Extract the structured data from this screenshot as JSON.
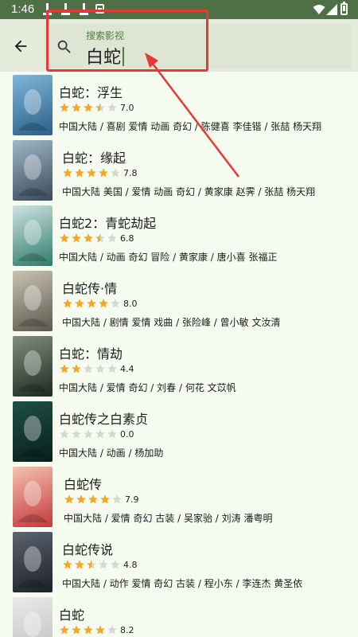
{
  "status_bar": {
    "time": "1:46"
  },
  "search": {
    "label": "搜索影视",
    "value": "白蛇"
  },
  "results": [
    {
      "title": "白蛇：浮生",
      "rating": 3.5,
      "score": "7.0",
      "meta": "中国大陆 / 喜剧 爱情 动画 奇幻 / 陈健喜 李佳锴 / 张喆 杨天翔",
      "colors": [
        "#7fb6d8",
        "#2c5f8a"
      ]
    },
    {
      "title": "白蛇：缘起",
      "rating": 4,
      "score": "7.8",
      "meta": "中国大陆 美国 / 爱情 动画 奇幻 / 黄家康 赵霁 / 张喆 杨天翔",
      "colors": [
        "#9fb7c8",
        "#3b4a5a"
      ]
    },
    {
      "title": "白蛇2：青蛇劫起",
      "rating": 3.5,
      "score": "6.8",
      "meta": "中国大陆 / 动画 奇幻 冒险 / 黄家康 / 唐小喜 张福正",
      "colors": [
        "#cde3e0",
        "#2f7b6a"
      ]
    },
    {
      "title": "白蛇传·情",
      "rating": 4,
      "score": "8.0",
      "meta": "中国大陆 / 剧情 爱情 戏曲 / 张险峰 / 曾小敏 文汝清",
      "colors": [
        "#c9c2b2",
        "#5a5a4e"
      ]
    },
    {
      "title": "白蛇：情劫",
      "rating": 2,
      "score": "4.4",
      "meta": "中国大陆 / 爱情 奇幻 / 刘春 / 何花 文苡帆",
      "colors": [
        "#7f8f7a",
        "#1e2a22"
      ]
    },
    {
      "title": "白蛇传之白素贞",
      "rating": 0,
      "score": "0.0",
      "meta": "中国大陆 / 动画 / 杨加助",
      "colors": [
        "#1f4f46",
        "#0a1f1c"
      ]
    },
    {
      "title": "白蛇传",
      "rating": 4,
      "score": "7.9",
      "meta": "中国大陆 / 爱情 奇幻 古装 / 吴家骀 / 刘涛 潘粤明",
      "colors": [
        "#f4c2b0",
        "#c4383a"
      ]
    },
    {
      "title": "白蛇传说",
      "rating": 2.5,
      "score": "4.8",
      "meta": "中国大陆 / 动作 爱情 奇幻 古装 / 程小东 / 李连杰 黄圣依",
      "colors": [
        "#5c6470",
        "#1c2028"
      ]
    },
    {
      "title": "白蛇",
      "rating": 4,
      "score": "8.2",
      "meta": "",
      "colors": [
        "#eaeaea",
        "#bdbdbd"
      ]
    }
  ],
  "row_offsets": [
    74,
    78,
    74,
    78,
    74,
    74,
    80,
    78,
    74
  ]
}
